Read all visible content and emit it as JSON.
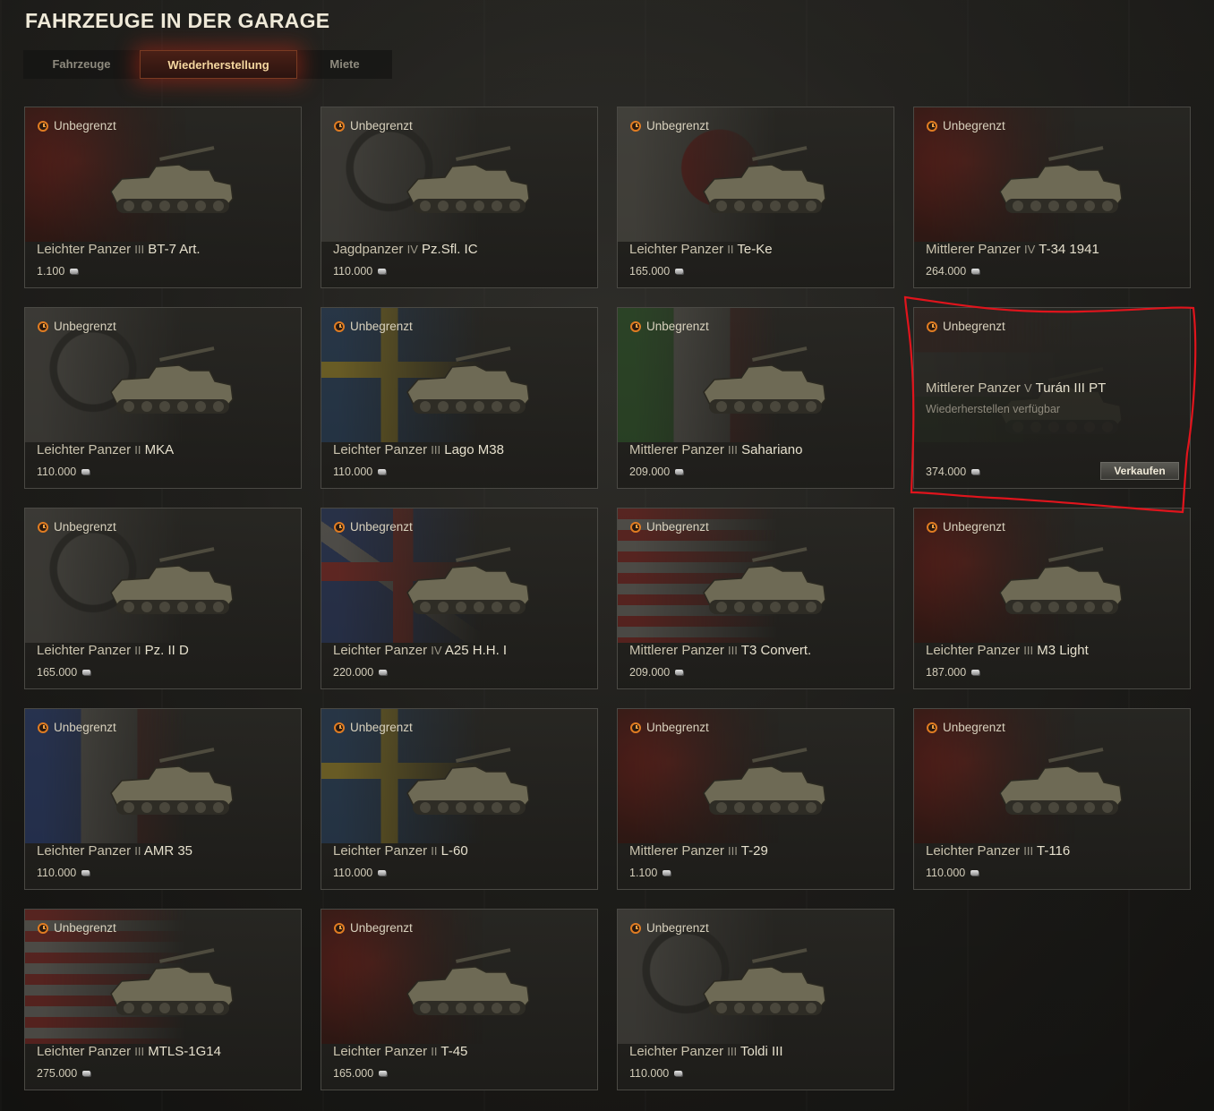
{
  "page": {
    "title": "FAHRZEUGE IN DER GARAGE"
  },
  "tabs": [
    {
      "label": "Fahrzeuge",
      "active": false
    },
    {
      "label": "Wiederherstellung",
      "active": true
    },
    {
      "label": "Miete",
      "active": false
    }
  ],
  "colors": {
    "accent": "#e07c22",
    "highlight_annotation": "#e0141c"
  },
  "vehicles": [
    {
      "timer": "Unbegrenzt",
      "class": "Leichter Panzer",
      "tier": "III",
      "model": "BT-7 Art.",
      "price": "1.100",
      "flag": "ussr"
    },
    {
      "timer": "Unbegrenzt",
      "class": "Jagdpanzer",
      "tier": "IV",
      "model": "Pz.Sfl. IC",
      "price": "110.000",
      "flag": "ger"
    },
    {
      "timer": "Unbegrenzt",
      "class": "Leichter Panzer",
      "tier": "II",
      "model": "Te-Ke",
      "price": "165.000",
      "flag": "jp"
    },
    {
      "timer": "Unbegrenzt",
      "class": "Mittlerer Panzer",
      "tier": "IV",
      "model": "T-34 1941",
      "price": "264.000",
      "flag": "ussr"
    },
    {
      "timer": "Unbegrenzt",
      "class": "Leichter Panzer",
      "tier": "II",
      "model": "MKA",
      "price": "110.000",
      "flag": "ger"
    },
    {
      "timer": "Unbegrenzt",
      "class": "Leichter Panzer",
      "tier": "III",
      "model": "Lago M38",
      "price": "110.000",
      "flag": "swe"
    },
    {
      "timer": "Unbegrenzt",
      "class": "Mittlerer Panzer",
      "tier": "III",
      "model": "Sahariano",
      "price": "209.000",
      "flag": "ita"
    },
    {
      "timer": "Unbegrenzt",
      "class": "Mittlerer Panzer",
      "tier": "V",
      "model": "Turán III PT",
      "price": "374.000",
      "flag": "hun",
      "status": "Wiederherstellen verfügbar",
      "sell_label": "Verkaufen"
    },
    {
      "timer": "Unbegrenzt",
      "class": "Leichter Panzer",
      "tier": "II",
      "model": "Pz. II D",
      "price": "165.000",
      "flag": "ger"
    },
    {
      "timer": "Unbegrenzt",
      "class": "Leichter Panzer",
      "tier": "IV",
      "model": "A25 H.H. I",
      "price": "220.000",
      "flag": "uk"
    },
    {
      "timer": "Unbegrenzt",
      "class": "Mittlerer Panzer",
      "tier": "III",
      "model": "T3 Convert.",
      "price": "209.000",
      "flag": "usa"
    },
    {
      "timer": "Unbegrenzt",
      "class": "Leichter Panzer",
      "tier": "III",
      "model": "M3 Light",
      "price": "187.000",
      "flag": "ussr"
    },
    {
      "timer": "Unbegrenzt",
      "class": "Leichter Panzer",
      "tier": "II",
      "model": "AMR 35",
      "price": "110.000",
      "flag": "fra"
    },
    {
      "timer": "Unbegrenzt",
      "class": "Leichter Panzer",
      "tier": "II",
      "model": "L-60",
      "price": "110.000",
      "flag": "swe"
    },
    {
      "timer": "Unbegrenzt",
      "class": "Mittlerer Panzer",
      "tier": "III",
      "model": "T-29",
      "price": "1.100",
      "flag": "ussr"
    },
    {
      "timer": "Unbegrenzt",
      "class": "Leichter Panzer",
      "tier": "III",
      "model": "T-116",
      "price": "110.000",
      "flag": "ussr"
    },
    {
      "timer": "Unbegrenzt",
      "class": "Leichter Panzer",
      "tier": "III",
      "model": "MTLS-1G14",
      "price": "275.000",
      "flag": "usa"
    },
    {
      "timer": "Unbegrenzt",
      "class": "Leichter Panzer",
      "tier": "II",
      "model": "T-45",
      "price": "165.000",
      "flag": "ussr"
    },
    {
      "timer": "Unbegrenzt",
      "class": "Leichter Panzer",
      "tier": "III",
      "model": "Toldi III",
      "price": "110.000",
      "flag": "ger"
    }
  ]
}
